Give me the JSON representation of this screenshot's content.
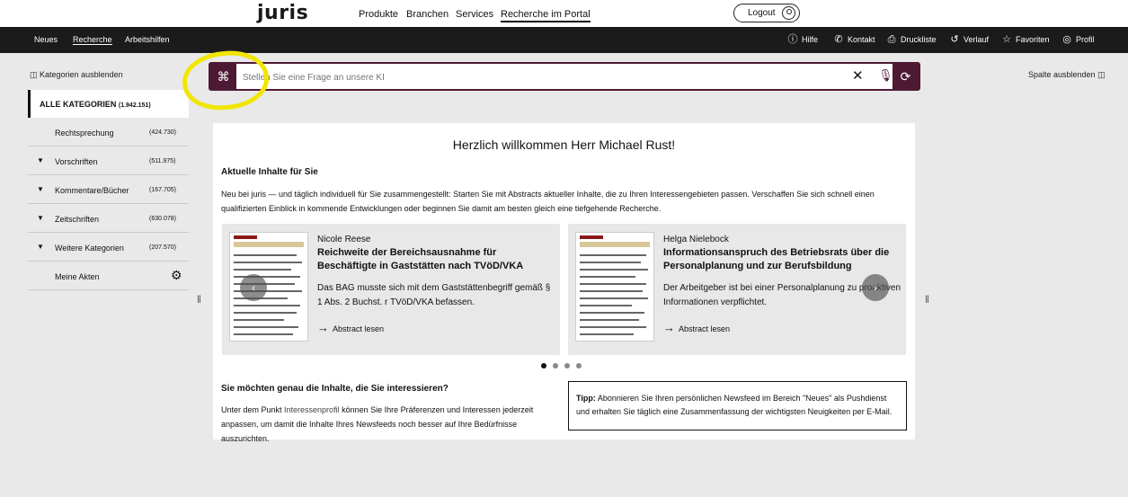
{
  "topbar": {
    "logo": "juris",
    "nav": [
      "Produkte",
      "Branchen",
      "Services",
      "Recherche im Portal"
    ],
    "logout": "Logout"
  },
  "blackbar": {
    "left": [
      "Neues",
      "Recherche",
      "Arbeitshilfen"
    ],
    "right": {
      "hilfe": "Hilfe",
      "kontakt": "Kontakt",
      "druckliste": "Druckliste",
      "verlauf": "Verlauf",
      "favoriten": "Favoriten",
      "profil": "Profil"
    }
  },
  "sidebar": {
    "toggle": "Kategorien ausblenden",
    "all": {
      "label": "ALLE KATEGORIEN",
      "count": "(1.942.151)"
    },
    "items": [
      {
        "label": "Rechtsprechung",
        "count": "(424.730)",
        "expandable": false
      },
      {
        "label": "Vorschriften",
        "count": "(511.975)",
        "expandable": true
      },
      {
        "label": "Kommentare/Bücher",
        "count": "(167.705)",
        "expandable": true
      },
      {
        "label": "Zeitschriften",
        "count": "(630.078)",
        "expandable": true
      },
      {
        "label": "Weitere Kategorien",
        "count": "(207.570)",
        "expandable": true
      }
    ],
    "akten": "Meine Akten"
  },
  "column_toggle": "Spalte ausblenden",
  "search": {
    "placeholder": "Stellen Sie eine Frage an unsere KI",
    "value": ""
  },
  "main": {
    "welcome": "Herzlich willkommen Herr Michael Rust!",
    "section_title": "Aktuelle Inhalte für Sie",
    "intro": "Neu bei juris — und täglich individuell für Sie zusammengestellt: Starten Sie mit Abstracts aktueller Inhalte, die zu Ihren Interessengebieten passen. Verschaffen Sie sich schnell einen qualifizierten Einblick in kommende Entwicklungen oder beginnen Sie damit am besten gleich eine tiefgehende Recherche.",
    "cards": [
      {
        "author": "Nicole Reese",
        "title": "Reichweite der Bereichsausnahme für Beschäftigte in Gaststätten nach TVöD/VKA",
        "text": "Das BAG musste sich mit dem Gaststättenbegriff gemäß § 1 Abs. 2 Buchst. r TVöD/VKA befassen.",
        "link": "Abstract lesen"
      },
      {
        "author": "Helga Nielebock",
        "title": "Informationsanspruch des Betriebsrats über die Personalplanung und zur Berufsbildung",
        "text": "Der Arbeitgeber ist bei einer Personalplanung zu proaktiven Informationen verpflichtet.",
        "link": "Abstract lesen"
      }
    ],
    "carousel_active": 1,
    "carousel_total": 4,
    "interest_title": "Sie möchten genau die Inhalte, die Sie interessieren?",
    "interest_pre": "Unter dem Punkt ",
    "interest_link": "Interessenprofil",
    "interest_post": " können Sie Ihre Präferenzen und Interessen jederzeit anpassen, um damit die Inhalte Ihres Newsfeeds noch besser auf Ihre Bedürfnisse auszurichten.",
    "tip_label": "Tipp:",
    "tip_text": " Abonnieren Sie Ihren persönlichen Newsfeed im Bereich \"Neues\" als Pushdienst und erhalten Sie täglich eine Zusammenfassung der wichtigsten Neuigkeiten per E-Mail."
  },
  "colors": {
    "accent": "#4e1a33",
    "highlight": "#f2e600",
    "dark": "#1b1b1b"
  }
}
